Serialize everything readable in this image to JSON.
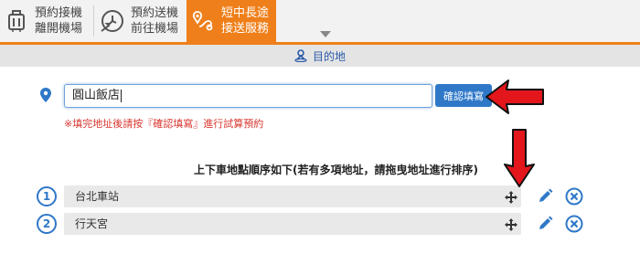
{
  "tabs": [
    {
      "label": "預約接機\n離開機場",
      "icon": "luggage-icon",
      "active": false
    },
    {
      "label": "預約送機\n前往機場",
      "icon": "plane-clock-icon",
      "active": false
    },
    {
      "label": "短中長途\n接送服務",
      "icon": "route-pin-icon",
      "active": true
    }
  ],
  "section": {
    "title": "目的地",
    "icon": "person-pin-icon"
  },
  "address": {
    "value": "圓山飯店",
    "confirm_label": "確認填寫",
    "hint": "※填完地址後請按『確認填寫』進行試算預約"
  },
  "order": {
    "title": "上下車地點順序如下(若有多項地址，請拖曳地址進行排序)",
    "stops": [
      {
        "num": "1",
        "name": "台北車站"
      },
      {
        "num": "2",
        "name": "行天宮"
      }
    ]
  },
  "colors": {
    "accent": "#ef7f1a",
    "primary": "#2f78c8",
    "hint": "#d9362f",
    "annotation_arrow": "#e3161c"
  }
}
